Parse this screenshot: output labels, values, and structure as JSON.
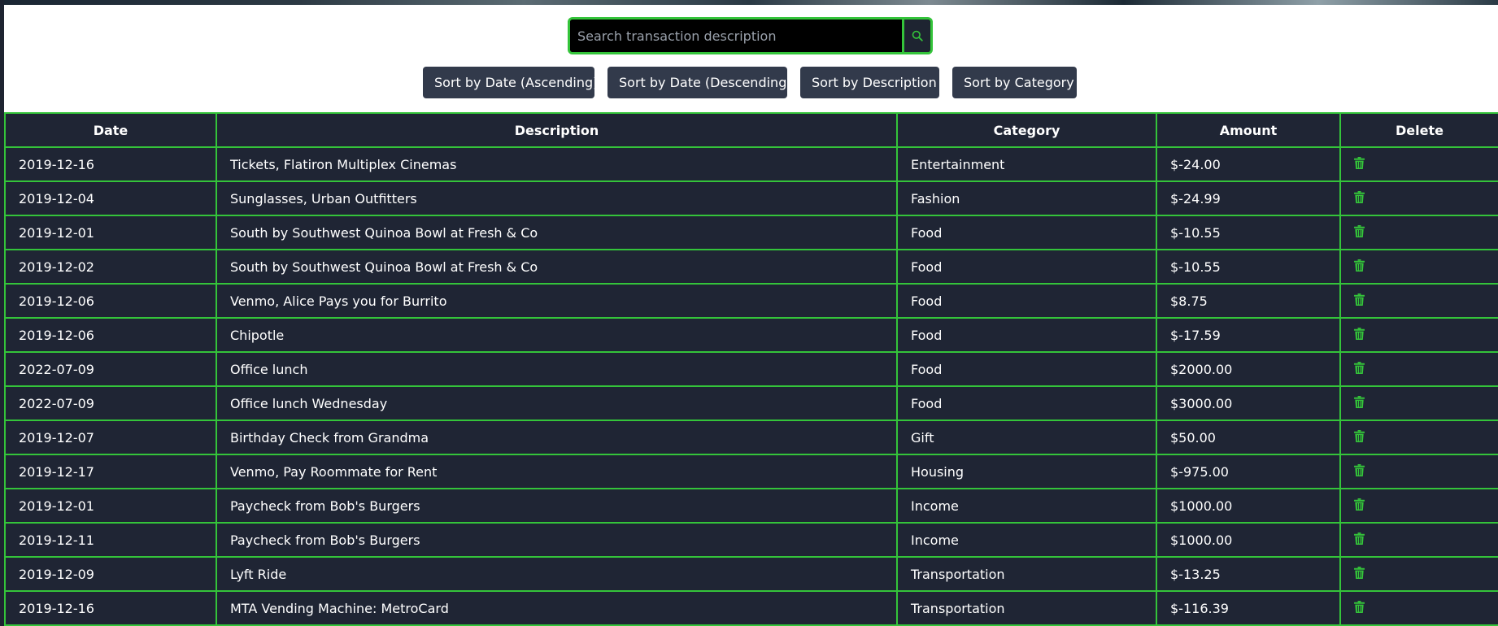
{
  "search": {
    "placeholder": "Search transaction description",
    "icon": "search-icon"
  },
  "sort_buttons": [
    {
      "label": "Sort by Date (Ascending)"
    },
    {
      "label": "Sort by Date (Descending)"
    },
    {
      "label": "Sort by Description"
    },
    {
      "label": "Sort by Category"
    }
  ],
  "table": {
    "headers": [
      "Date",
      "Description",
      "Category",
      "Amount",
      "Delete"
    ],
    "rows": [
      {
        "date": "2019-12-16",
        "description": "Tickets, Flatiron Multiplex Cinemas",
        "category": "Entertainment",
        "amount": "$-24.00"
      },
      {
        "date": "2019-12-04",
        "description": "Sunglasses, Urban Outfitters",
        "category": "Fashion",
        "amount": "$-24.99"
      },
      {
        "date": "2019-12-01",
        "description": "South by Southwest Quinoa Bowl at Fresh & Co",
        "category": "Food",
        "amount": "$-10.55"
      },
      {
        "date": "2019-12-02",
        "description": "South by Southwest Quinoa Bowl at Fresh & Co",
        "category": "Food",
        "amount": "$-10.55"
      },
      {
        "date": "2019-12-06",
        "description": "Venmo, Alice Pays you for Burrito",
        "category": "Food",
        "amount": "$8.75"
      },
      {
        "date": "2019-12-06",
        "description": "Chipotle",
        "category": "Food",
        "amount": "$-17.59"
      },
      {
        "date": "2022-07-09",
        "description": "Office lunch",
        "category": "Food",
        "amount": "$2000.00"
      },
      {
        "date": "2022-07-09",
        "description": "Office lunch Wednesday",
        "category": "Food",
        "amount": "$3000.00"
      },
      {
        "date": "2019-12-07",
        "description": "Birthday Check from Grandma",
        "category": "Gift",
        "amount": "$50.00"
      },
      {
        "date": "2019-12-17",
        "description": "Venmo, Pay Roommate for Rent",
        "category": "Housing",
        "amount": "$-975.00"
      },
      {
        "date": "2019-12-01",
        "description": "Paycheck from Bob's Burgers",
        "category": "Income",
        "amount": "$1000.00"
      },
      {
        "date": "2019-12-11",
        "description": "Paycheck from Bob's Burgers",
        "category": "Income",
        "amount": "$1000.00"
      },
      {
        "date": "2019-12-09",
        "description": "Lyft Ride",
        "category": "Transportation",
        "amount": "$-13.25"
      },
      {
        "date": "2019-12-16",
        "description": "MTA Vending Machine: MetroCard",
        "category": "Transportation",
        "amount": "$-116.39"
      }
    ]
  },
  "colors": {
    "accent": "#34c43a",
    "table_bg": "#1f2534",
    "button_bg": "#323a4b",
    "search_bg": "#000000"
  },
  "icons": {
    "delete": "trash-icon"
  }
}
